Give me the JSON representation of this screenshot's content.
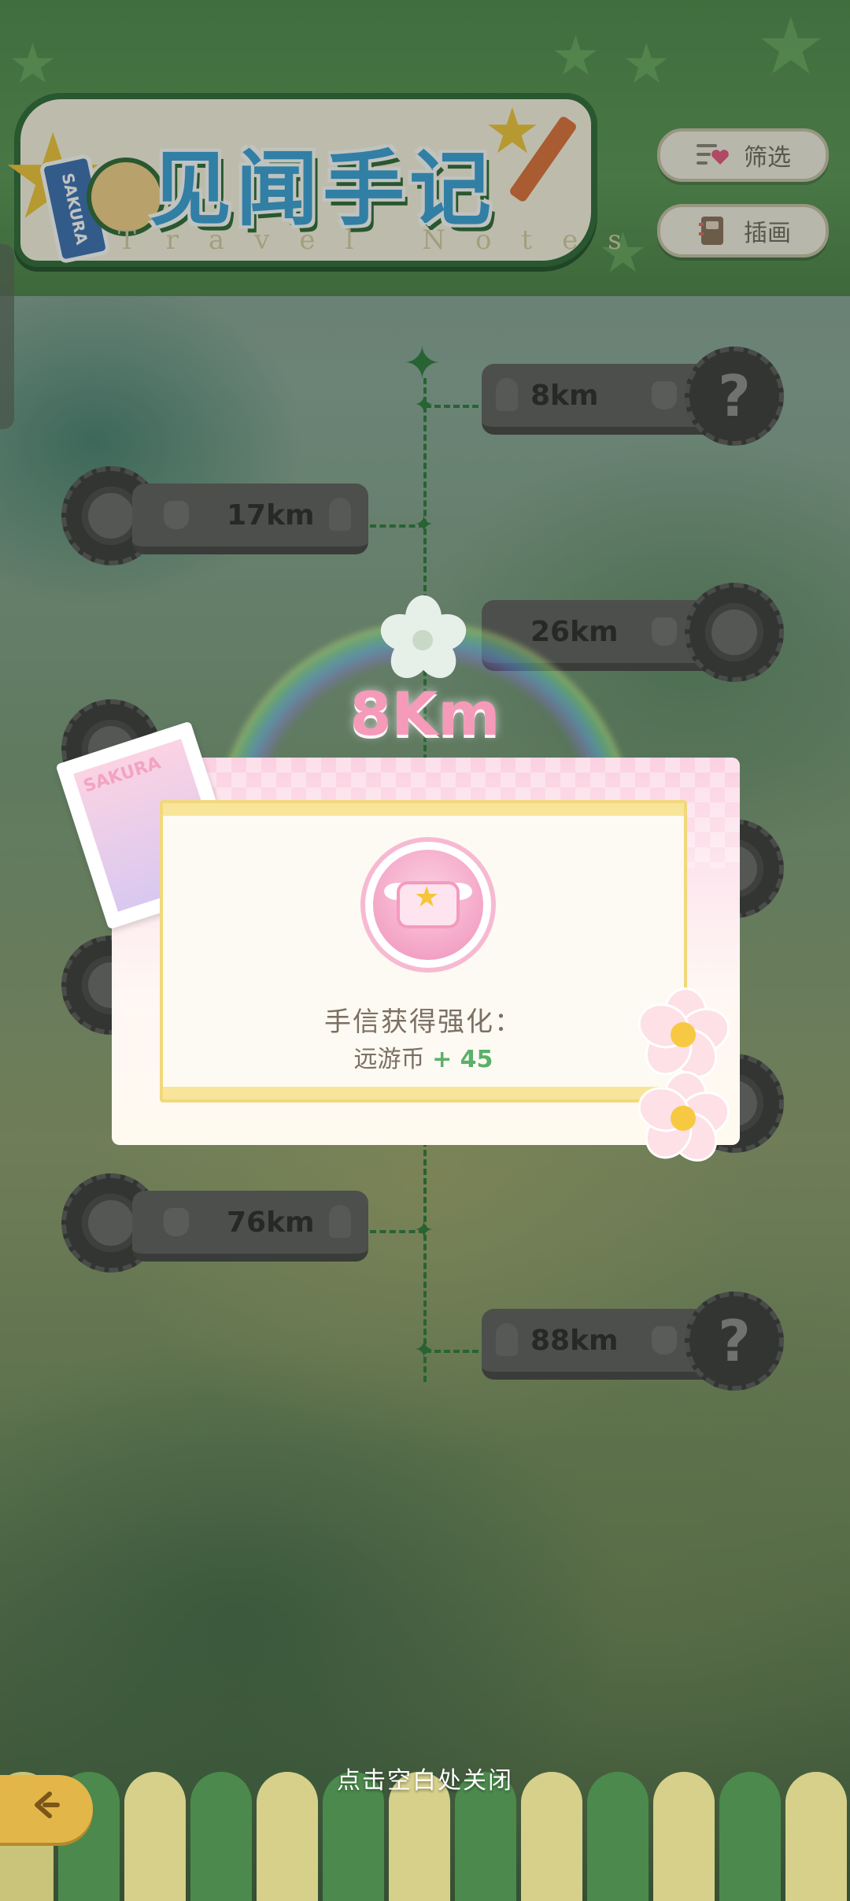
{
  "header": {
    "logo_title": "见闻手记",
    "logo_subtitle": "Travel Notes",
    "logo_tag": "SAKURA",
    "filter_button": "筛选",
    "illustration_button": "插画"
  },
  "timeline": {
    "nodes": [
      {
        "km": "8km",
        "side": "right",
        "medal": "?"
      },
      {
        "km": "17km",
        "side": "left",
        "medal": ""
      },
      {
        "km": "26km",
        "side": "right",
        "medal": ""
      },
      {
        "km": "76km",
        "side": "left",
        "medal": ""
      },
      {
        "km": "88km",
        "side": "right",
        "medal": "?"
      }
    ]
  },
  "reward": {
    "distance": "8Km",
    "stamp_text": "SAKURA",
    "message": "手信获得强化：",
    "currency_label": "远游币",
    "currency_amount": "+ 45"
  },
  "close_hint": "点击空白处关闭",
  "colors": {
    "header_green": "#4f8a4c",
    "distance_pink": "#f59ab9",
    "plus_green": "#5bb06a",
    "card_yellow": "#f9e59a"
  },
  "icons": {
    "filter": "list-heart-icon",
    "illustration": "book-icon",
    "back": "back-arrow-icon",
    "coin": "suitcase-coin-icon"
  }
}
